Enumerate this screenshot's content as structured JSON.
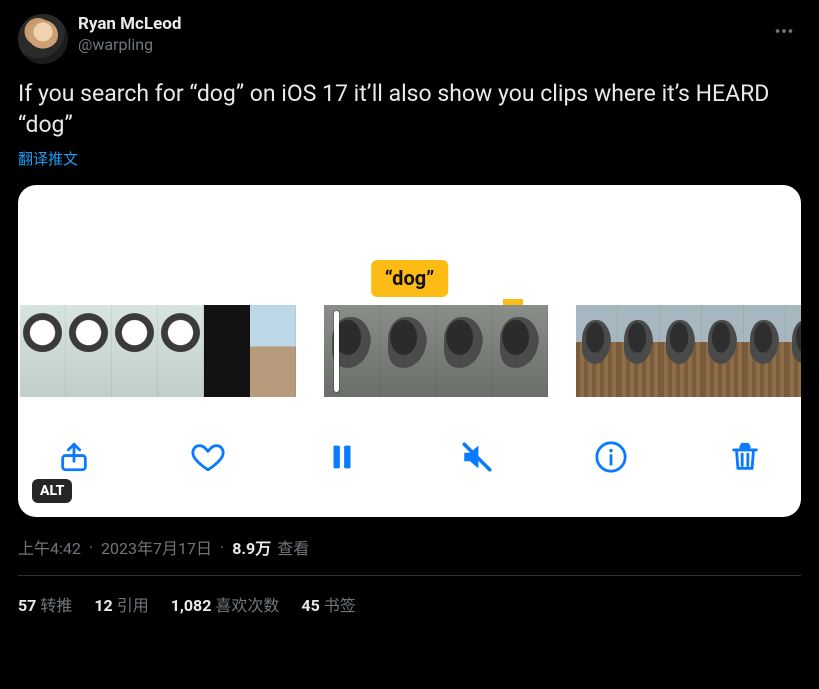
{
  "author": {
    "display_name": "Ryan McLeod",
    "handle": "@warpling"
  },
  "body": "If you search for “dog” on iOS 17 it’ll also show you clips where it’s HEARD “dog”",
  "translate_label": "翻译推文",
  "media": {
    "chip_label": "“dog”",
    "alt_badge": "ALT",
    "toolbar": {
      "share": "share",
      "like": "like",
      "pause": "pause",
      "mute": "mute",
      "info": "info",
      "trash": "trash"
    }
  },
  "meta": {
    "time": "上午4:42",
    "date": "2023年7月17日",
    "views_count": "8.9万",
    "views_label": "查看"
  },
  "stats": {
    "retweets": {
      "count": "57",
      "label": "转推"
    },
    "quotes": {
      "count": "12",
      "label": "引用"
    },
    "likes": {
      "count": "1,082",
      "label": "喜欢次数"
    },
    "bookmarks": {
      "count": "45",
      "label": "书签"
    }
  }
}
